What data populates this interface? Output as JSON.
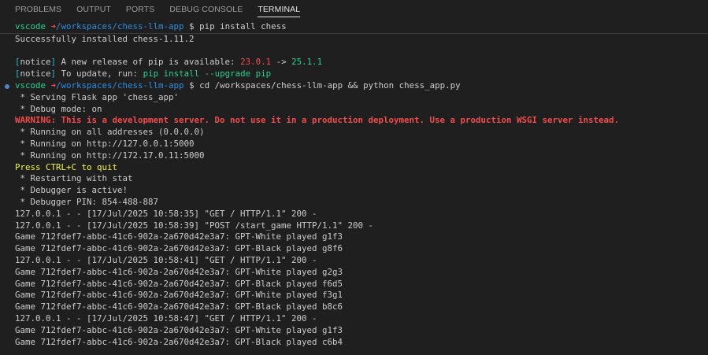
{
  "tabs": [
    "PROBLEMS",
    "OUTPUT",
    "PORTS",
    "DEBUG CONSOLE",
    "TERMINAL"
  ],
  "active_tab": "TERMINAL",
  "colors": {
    "background": "#1f1f1f",
    "text": "#cccccc",
    "prompt_user": "#23d18b",
    "prompt_arrow": "#f14c4c",
    "path": "#2a8ee0",
    "notice_bracket": "#29b8db",
    "version_old": "#f14c4c",
    "version_new": "#23d18b",
    "warning": "#f14c4c",
    "quit_hint": "#f5f543"
  },
  "terminal": {
    "prompt1": {
      "user": "vscode",
      "arrow": "➜",
      "path": "/workspaces/chess-llm-app",
      "dollar": "$",
      "command": "pip install chess"
    },
    "installed": "Successfully installed chess-1.11.2",
    "notice1": {
      "tag": "notice",
      "text": " A new release of pip is available: ",
      "old_version": "23.0.1",
      "arrow": " -> ",
      "new_version": "25.1.1"
    },
    "notice2": {
      "tag": "notice",
      "text": " To update, run: ",
      "command": "pip install --upgrade pip"
    },
    "prompt2": {
      "user": "vscode",
      "arrow": "➜",
      "path": "/workspaces/chess-llm-app",
      "dollar": "$",
      "command": "cd /workspaces/chess-llm-app && python chess_app.py"
    },
    "flask_lines_before": [
      " * Serving Flask app 'chess_app'",
      " * Debug mode: on"
    ],
    "warning": "WARNING: This is a development server. Do not use it in a production deployment. Use a production WSGI server instead.",
    "flask_lines_after": [
      " * Running on all addresses (0.0.0.0)",
      " * Running on http://127.0.0.1:5000",
      " * Running on http://172.17.0.11:5000"
    ],
    "quit_hint": "Press CTRL+C to quit",
    "debug_lines": [
      " * Restarting with stat",
      " * Debugger is active!",
      " * Debugger PIN: 854-488-887"
    ],
    "log_lines": [
      "127.0.0.1 - - [17/Jul/2025 10:58:35] \"GET / HTTP/1.1\" 200 -",
      "127.0.0.1 - - [17/Jul/2025 10:58:39] \"POST /start_game HTTP/1.1\" 200 -",
      "Game 712fdef7-abbc-41c6-902a-2a670d42e3a7: GPT-White played g1f3",
      "Game 712fdef7-abbc-41c6-902a-2a670d42e3a7: GPT-Black played g8f6",
      "127.0.0.1 - - [17/Jul/2025 10:58:41] \"GET / HTTP/1.1\" 200 -",
      "Game 712fdef7-abbc-41c6-902a-2a670d42e3a7: GPT-White played g2g3",
      "Game 712fdef7-abbc-41c6-902a-2a670d42e3a7: GPT-Black played f6d5",
      "Game 712fdef7-abbc-41c6-902a-2a670d42e3a7: GPT-White played f3g1",
      "Game 712fdef7-abbc-41c6-902a-2a670d42e3a7: GPT-Black played b8c6",
      "127.0.0.1 - - [17/Jul/2025 10:58:47] \"GET / HTTP/1.1\" 200 -",
      "Game 712fdef7-abbc-41c6-902a-2a670d42e3a7: GPT-White played g1f3",
      "Game 712fdef7-abbc-41c6-902a-2a670d42e3a7: GPT-Black played c6b4"
    ]
  }
}
